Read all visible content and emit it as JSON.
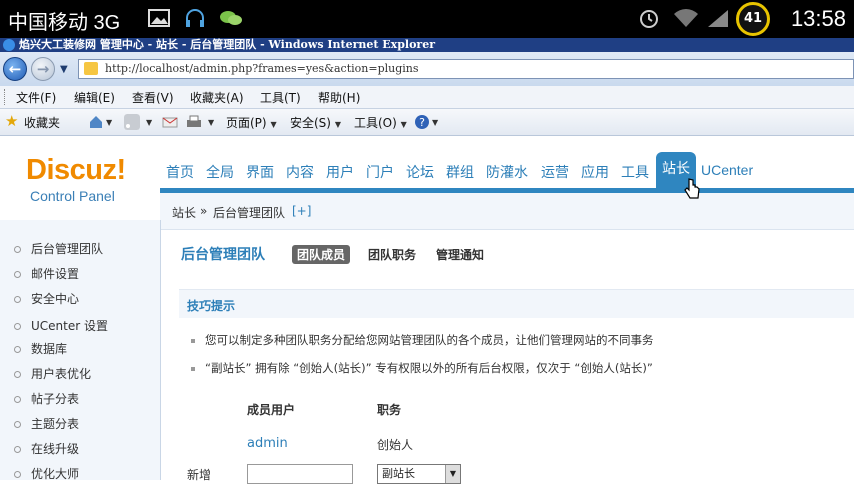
{
  "statusbar": {
    "carrier": "中国移动 3G",
    "battery_level": "41",
    "clock": "13:58",
    "icons": [
      "image-icon",
      "headset-icon",
      "wechat-icon",
      "alarm-icon",
      "wifi-icon",
      "signal-icon"
    ]
  },
  "browser": {
    "title": "焰兴大工装修网 管理中心 - 站长 - 后台管理团队 - Windows Internet Explorer",
    "address": "http://localhost/admin.php?frames=yes&action=plugins",
    "menu": [
      "文件(F)",
      "编辑(E)",
      "查看(V)",
      "收藏夹(A)",
      "工具(T)",
      "帮助(H)"
    ],
    "favorites_label": "收藏夹",
    "toolbar": {
      "page": "页面(P)",
      "safety": "安全(S)",
      "tools": "工具(O)"
    }
  },
  "discuz": {
    "logo": "Discuz!",
    "logo_sub": "Control Panel",
    "nav": [
      "首页",
      "全局",
      "界面",
      "内容",
      "用户",
      "门户",
      "论坛",
      "群组",
      "防灌水",
      "运营",
      "应用",
      "工具",
      "站长",
      "UCenter"
    ],
    "active_nav": "站长",
    "breadcrumb": {
      "root": "站长",
      "sep": "»",
      "current": "后台管理团队",
      "plus": "[+]"
    },
    "sidebar": [
      "后台管理团队",
      "邮件设置",
      "安全中心",
      "UCenter 设置",
      "数据库",
      "用户表优化",
      "帖子分表",
      "主题分表",
      "在线升级",
      "优化大师"
    ],
    "main": {
      "title": "后台管理团队",
      "tabs": [
        "团队成员",
        "团队职务",
        "管理通知"
      ],
      "active_tab": "团队成员",
      "tips_title": "技巧提示",
      "tips": [
        "您可以制定多种团队职务分配给您网站管理团队的各个成员，让他们管理网站的不同事务",
        "“副站长” 拥有除 “创始人(站长)” 专有权限以外的所有后台权限，仅次于 “创始人(站长)”"
      ],
      "table": {
        "headers": [
          "成员用户",
          "职务"
        ],
        "rows": [
          {
            "user": "admin",
            "role": "创始人"
          }
        ]
      },
      "new_label": "新增",
      "new_role_value": "副站长"
    }
  },
  "colors": {
    "accent": "#2f86c0",
    "logo": "#f08a00",
    "ie_title": "#1f3f84"
  }
}
